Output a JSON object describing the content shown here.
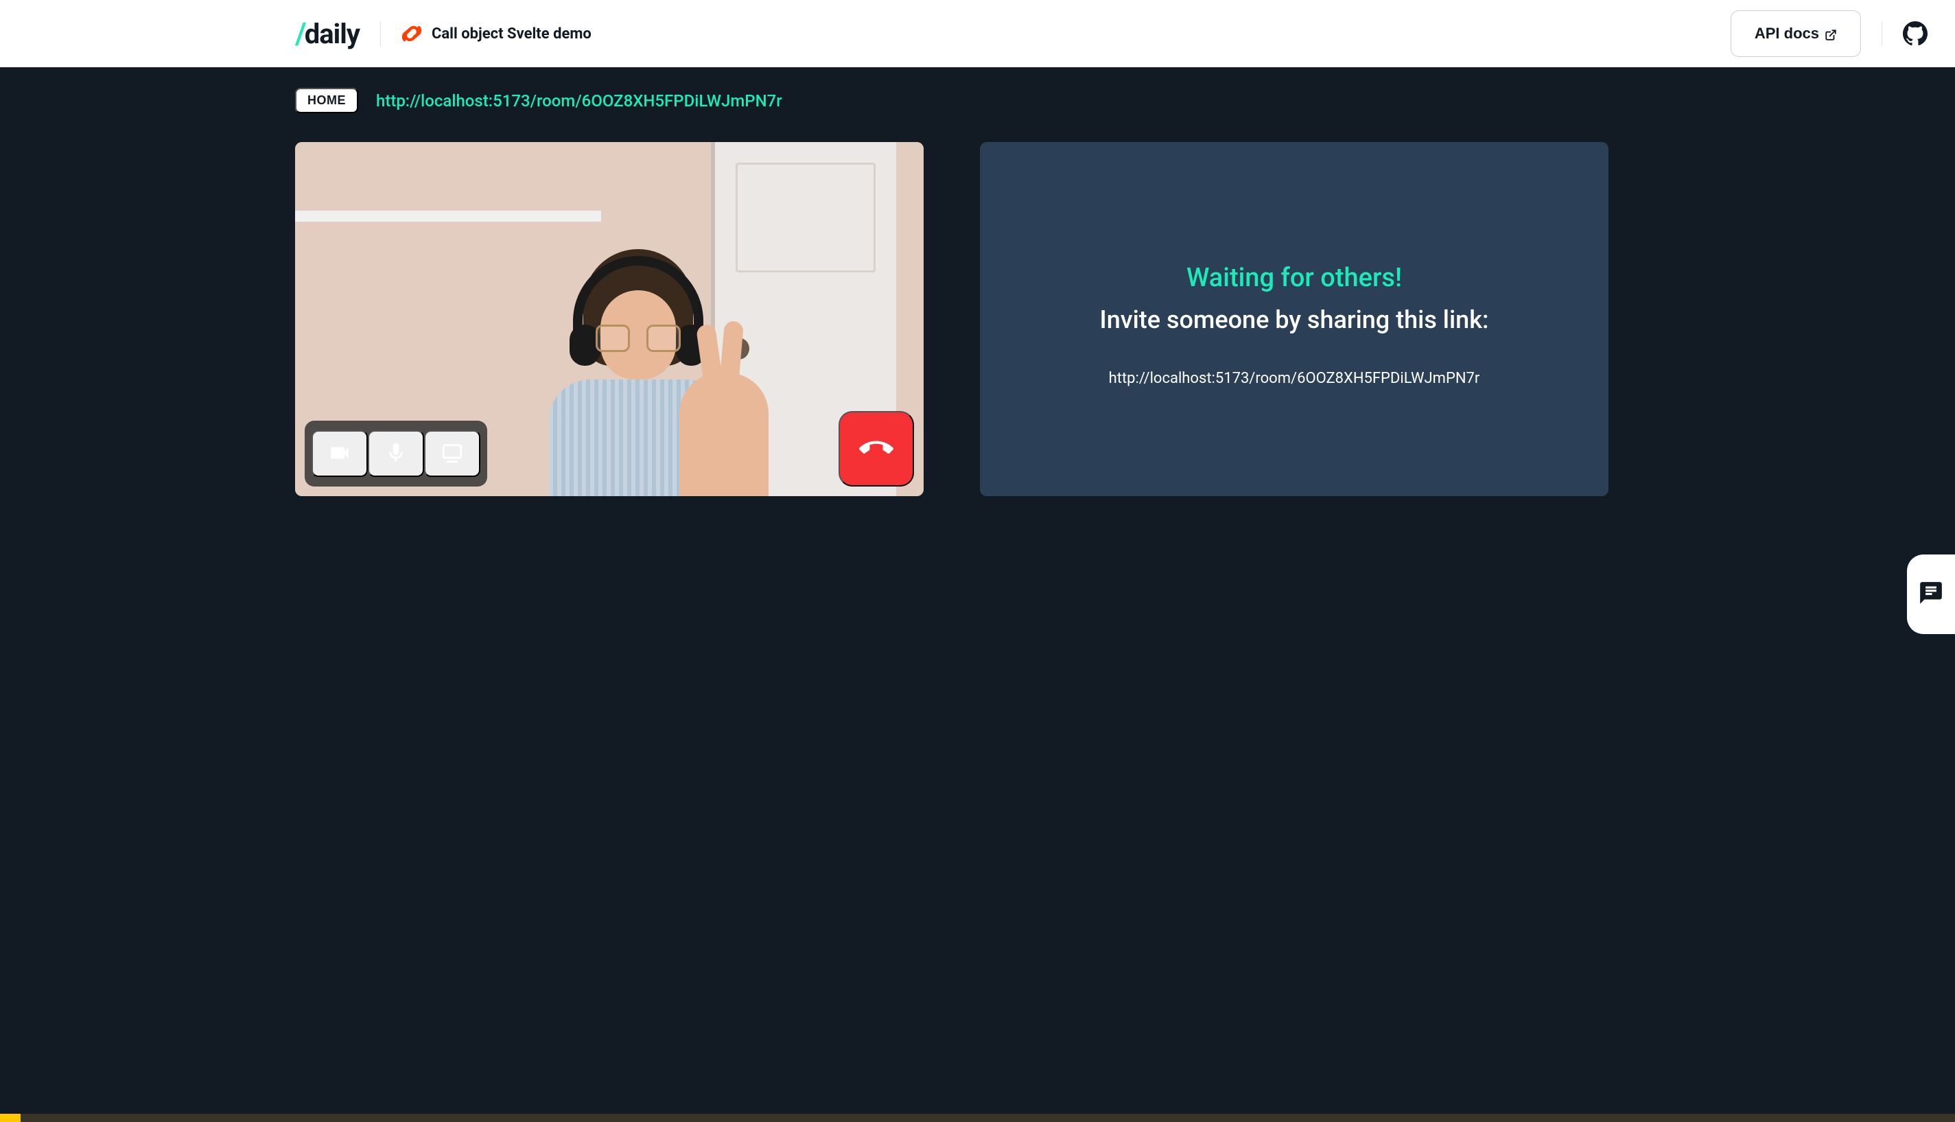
{
  "header": {
    "logo_text": "daily",
    "title": "Call object Svelte demo",
    "api_docs_label": "API docs"
  },
  "breadcrumb": {
    "home_label": "HOME",
    "room_url": "http://localhost:5173/room/6OOZ8XH5FPDiLWJmPN7r"
  },
  "waiting": {
    "title": "Waiting for others!",
    "subtitle": "Invite someone by sharing this link:",
    "link": "http://localhost:5173/room/6OOZ8XH5FPDiLWJmPN7r"
  },
  "colors": {
    "accent": "#1bebb9",
    "background": "#121a24",
    "tile": "#2b3f56",
    "hangup": "#f63135"
  }
}
